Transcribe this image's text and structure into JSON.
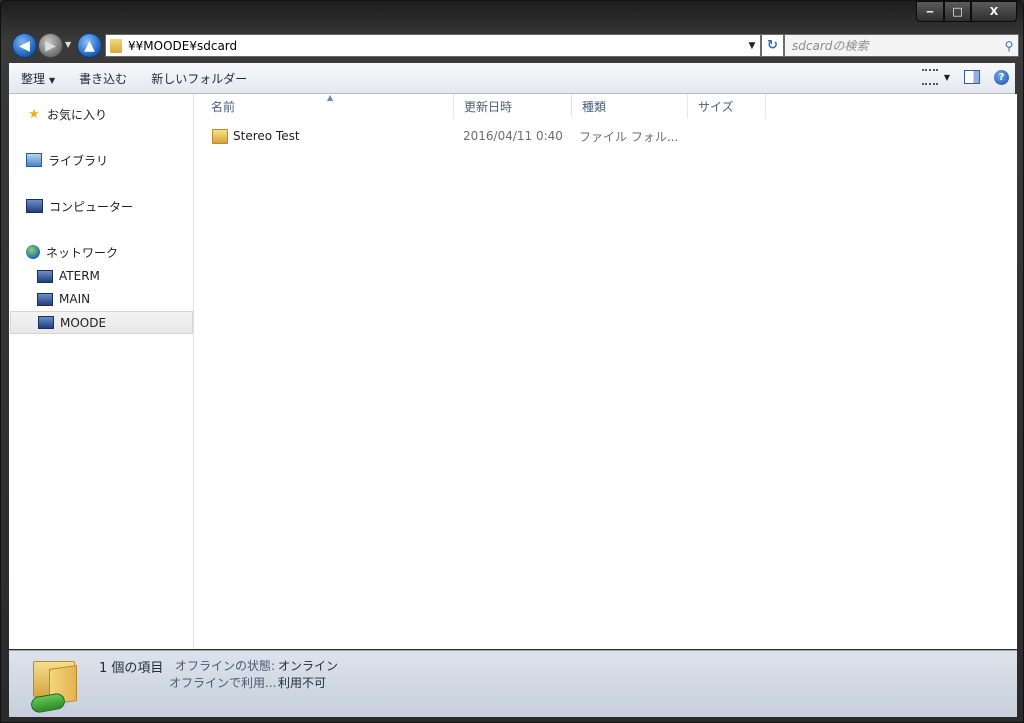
{
  "window": {
    "minimize": "‒",
    "maximize": "□",
    "close": "X"
  },
  "address": {
    "path": "¥¥MOODE¥sdcard",
    "search_placeholder": "sdcardの検索"
  },
  "toolbar": {
    "organize": "整理",
    "burn": "書き込む",
    "new_folder": "新しいフォルダー"
  },
  "sidebar": {
    "favorites": "お気に入り",
    "libraries": "ライブラリ",
    "computer": "コンピューター",
    "network": "ネットワーク",
    "network_items": [
      "ATERM",
      "MAIN",
      "MOODE"
    ],
    "selected": "MOODE"
  },
  "columns": {
    "name": "名前",
    "date": "更新日時",
    "type": "種類",
    "size": "サイズ"
  },
  "files": [
    {
      "name": "Stereo Test",
      "date": "2016/04/11 0:40",
      "type": "ファイル フォル...",
      "size": ""
    }
  ],
  "status": {
    "count": "1 個の項目",
    "offline_state_label": "オフラインの状態:",
    "offline_state_value": "オンライン",
    "offline_avail_label": "オフラインで利用...",
    "offline_avail_value": "利用不可"
  }
}
